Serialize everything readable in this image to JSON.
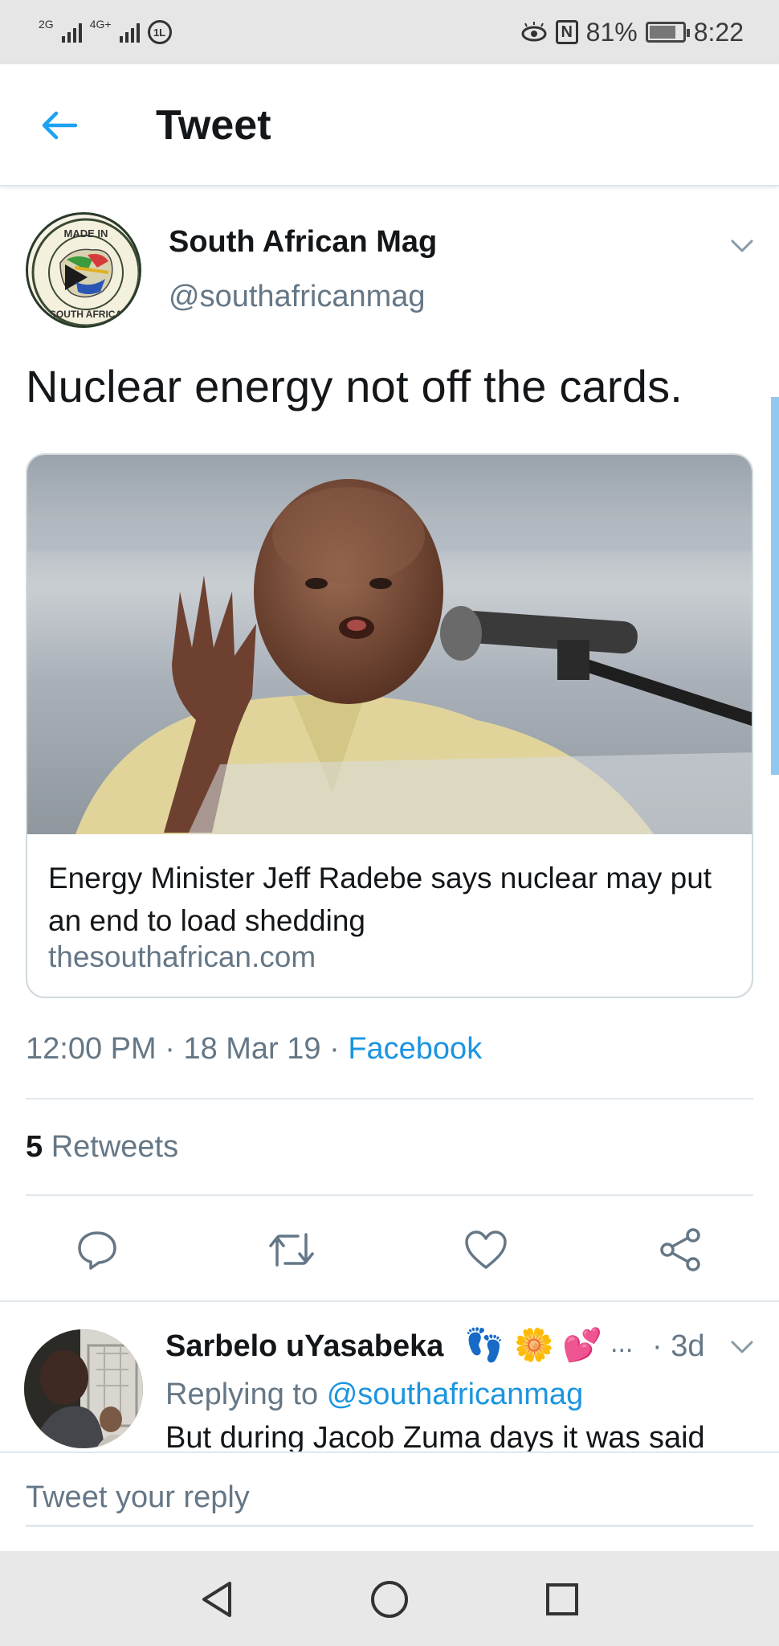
{
  "status_bar": {
    "net1": "2G",
    "net2": "4G+",
    "battery_percent": "81%",
    "time": "8:22"
  },
  "header": {
    "title": "Tweet"
  },
  "tweet": {
    "author_name": "South African Mag",
    "author_handle": "@southafricanmag",
    "logo_text_top": "MADE IN",
    "logo_text_bottom": "SOUTH AFRICA",
    "text": "Nuclear energy not off the cards.",
    "card": {
      "title": "Energy Minister Jeff Radebe says nuclear may put an end to load shedding",
      "domain": "thesouthafrican.com"
    },
    "time": "12:00 PM",
    "date": "18 Mar 19",
    "source": "Facebook",
    "retweet_count": "5",
    "retweets_label": "Retweets"
  },
  "reply": {
    "name": "Sarbelo uYasabeka",
    "emojis": [
      "👣",
      "🌼",
      "💕"
    ],
    "ellipsis": "...",
    "age": "· 3d",
    "replying_to_label": "Replying to",
    "replying_to_handle": "@southafricanmag",
    "text": "But during Jacob Zuma days it was said"
  },
  "compose": {
    "placeholder": "Tweet your reply"
  },
  "colors": {
    "accent": "#1b95e0",
    "secondary_text": "#657786",
    "divider": "#e1e8ed"
  },
  "icons": [
    "back-arrow-icon",
    "chevron-down-icon",
    "reply-icon",
    "retweet-icon",
    "like-icon",
    "share-icon",
    "nav-back-icon",
    "nav-home-icon",
    "nav-recents-icon"
  ]
}
